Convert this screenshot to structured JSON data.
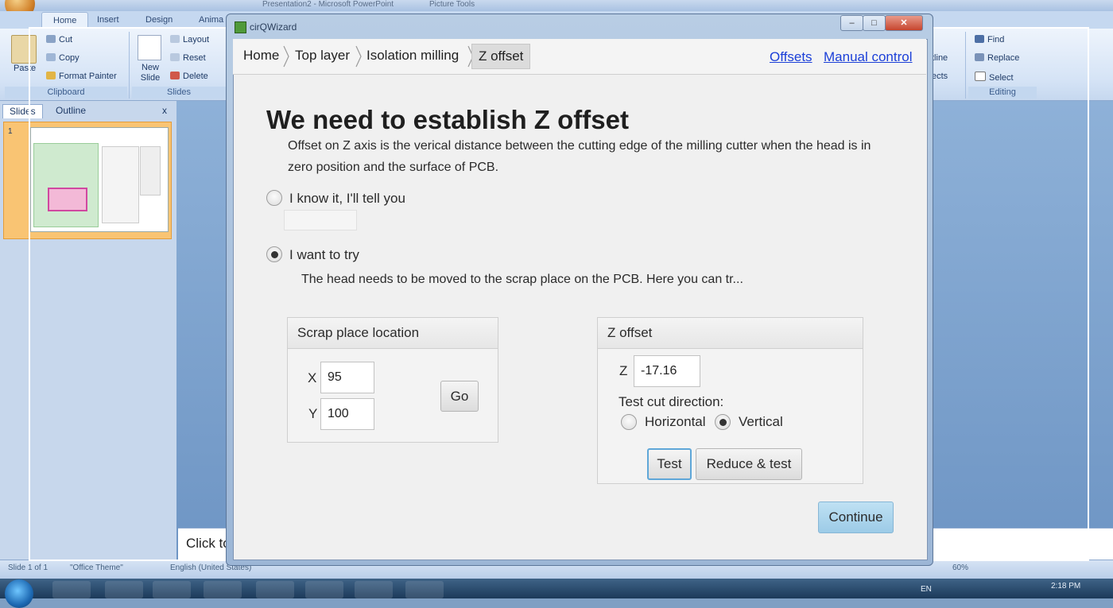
{
  "powerpoint": {
    "title_text": "Presentation2 - Microsoft PowerPoint",
    "picture_tools": "Picture Tools",
    "tabs": [
      "Home",
      "Insert",
      "Design",
      "Anima"
    ],
    "clipboard": {
      "paste": "Paste",
      "cut": "Cut",
      "copy": "Copy",
      "format_painter": "Format Painter",
      "group_label": "Clipboard"
    },
    "slides_group": {
      "new_slide": "New Slide",
      "layout": "Layout",
      "reset": "Reset",
      "delete": "Delete",
      "group_label": "Slides"
    },
    "right_group": {
      "outline": "tline",
      "effects": "ects"
    },
    "editing": {
      "find": "Find",
      "replace": "Replace",
      "select": "Select",
      "group_label": "Editing"
    },
    "pane_tabs": [
      "Slides",
      "Outline"
    ],
    "pane_close": "x",
    "slide_number": "1",
    "notes_placeholder": "Click to",
    "status": {
      "slide": "Slide 1 of 1",
      "theme": "\"Office Theme\"",
      "language": "English (United States)",
      "zoom": "60%"
    },
    "tray": {
      "lang": "EN",
      "time": "2:18 PM"
    }
  },
  "window": {
    "title": "cirQWizard",
    "controls": [
      "–",
      "□",
      "✕"
    ]
  },
  "breadcrumbs": [
    "Home",
    "Top layer",
    "Isolation milling",
    "Z offset"
  ],
  "nav_links": {
    "offsets": "Offsets",
    "manual_control": "Manual control"
  },
  "heading": "We need to establish Z offset",
  "description": "Offset on Z axis is the verical distance between the cutting edge of the milling cutter when the head is in zero position and the surface of PCB.",
  "option_know": {
    "label": "I know it, I'll tell you",
    "selected": false,
    "value": ""
  },
  "option_try": {
    "label": "I want to try",
    "selected": true
  },
  "hint": "The head needs to be moved to the scrap place on the PCB. Here you can tr...",
  "scrap_panel": {
    "title": "Scrap place location",
    "x_label": "X",
    "x_value": "95",
    "y_label": "Y",
    "y_value": "100",
    "go_button": "Go"
  },
  "z_panel": {
    "title": "Z offset",
    "z_label": "Z",
    "z_value": "-17.16",
    "direction_label": "Test cut direction:",
    "horizontal": "Horizontal",
    "vertical": "Vertical",
    "selected_direction": "Vertical",
    "test_button": "Test",
    "reduce_button": "Reduce & test"
  },
  "continue_button": "Continue"
}
